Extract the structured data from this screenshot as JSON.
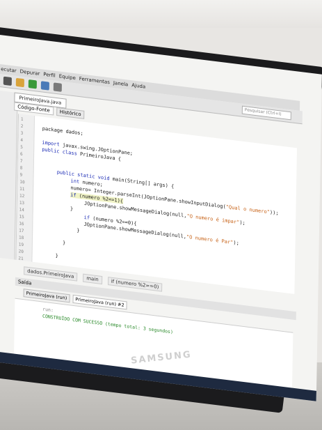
{
  "menu": [
    "ecutar",
    "Depurar",
    "Perfil",
    "Equipe",
    "Ferramentas",
    "Janela",
    "Ajuda"
  ],
  "search_placeholder": "Pesquisar (Ctrl+I)",
  "file_tab": "PrimeiroJava.java",
  "subtabs": [
    "Código-Fonte",
    "Histórico"
  ],
  "line_numbers": [
    "1",
    "2",
    "3",
    "4",
    "5",
    "6",
    "7",
    "8",
    "9",
    "10",
    "11",
    "12",
    "13",
    "14",
    "15",
    "16",
    "17",
    "18",
    "19",
    "20",
    "21"
  ],
  "code": {
    "l2": "package dados;",
    "l4a": "import",
    "l4b": " javax.swing.JOptionPane;",
    "l5a": "public class",
    "l5b": " PrimeiroJava {",
    "l8a": "public static void",
    "l8b": " main(String[] args) {",
    "l9a": "int",
    "l9b": " numero;",
    "l10a": "numero= Integer.parseInt(JOptionPane.showInputDialog(",
    "l10b": "\"Qual o numero\"",
    "l10c": "));",
    "l11a": "if",
    "l11b": " (numero %2==1){",
    "l12a": "JOptionPane.showMessageDialog(null,",
    "l12b": "\"O numero é impar\"",
    "l12c": ");",
    "l13": "}",
    "l14a": "if",
    "l14b": " (numero %2==0){",
    "l15a": "JOptionPane.showMessageDialog(null,",
    "l15b": "\"O numero é Par\"",
    "l15c": ");",
    "l16": "}",
    "l18": "}",
    "l20": "}"
  },
  "nav": [
    "dados.PrimeiroJava",
    "main",
    "if (numero %2==0)"
  ],
  "output_title": "Saída",
  "output_tabs": [
    "PrimeiroJava (run)",
    "PrimeiroJava (run) #2"
  ],
  "output_lines": [
    "run:",
    "CONSTRUÍDO COM SUCESSO (tempo total: 3 segundos)"
  ],
  "brand": "SAMSUNG",
  "colors": {
    "keyword": "#1b2bb5",
    "string": "#c8641a",
    "success": "#2a8a2a"
  }
}
